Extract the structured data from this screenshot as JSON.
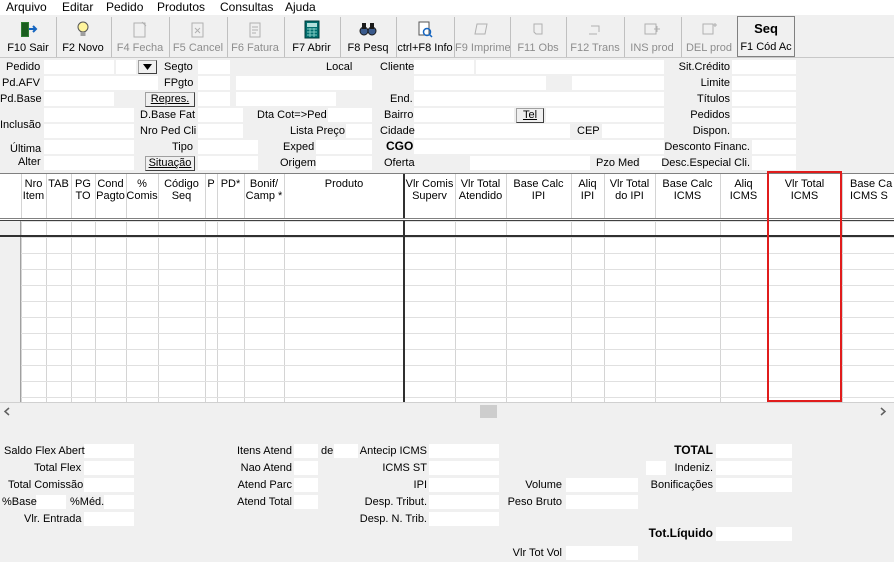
{
  "menu": [
    "Arquivo",
    "Editar",
    "Pedido",
    "Produtos",
    "Consultas",
    "Ajuda"
  ],
  "toolbar": [
    {
      "label": "F10 Sair",
      "icon": "exit-icon",
      "enabled": true
    },
    {
      "label": "F2 Novo",
      "icon": "lightbulb-icon",
      "enabled": true
    },
    {
      "label": "F4 Fecha",
      "icon": "close-doc-icon",
      "enabled": false
    },
    {
      "label": "F5 Cancel",
      "icon": "cancel-doc-icon",
      "enabled": false
    },
    {
      "label": "F6 Fatura",
      "icon": "invoice-icon",
      "enabled": false
    },
    {
      "label": "F7 Abrir",
      "icon": "calculator-icon",
      "enabled": true
    },
    {
      "label": "F8 Pesq",
      "icon": "binoculars-icon",
      "enabled": true
    },
    {
      "label": "ctrl+F8 Info",
      "icon": "info-search-icon",
      "enabled": true
    },
    {
      "label": "F9 Imprime",
      "icon": "printer-icon",
      "enabled": false
    },
    {
      "label": "F11 Obs",
      "icon": "note-icon",
      "enabled": false
    },
    {
      "label": "F12 Trans",
      "icon": "transfer-icon",
      "enabled": false
    },
    {
      "label": "INS prod",
      "icon": "insert-icon",
      "enabled": false
    },
    {
      "label": "DEL prod",
      "icon": "delete-icon",
      "enabled": false
    }
  ],
  "seq": {
    "title": "Seq",
    "label": "F1 Cód Ac"
  },
  "form": {
    "pedido": "Pedido",
    "pd_afv": "Pd.AFV",
    "pd_base": "Pd.Base",
    "inclusao": "Inclusão",
    "ultima": "Última",
    "alter": "Alter",
    "segto": "Segto",
    "fpgto": "FPgto",
    "repres": "Repres.",
    "d_base_fat": "D.Base Fat",
    "nro_ped_cli": "Nro Ped Cli",
    "tipo": "Tipo",
    "situacao": "Situação",
    "local": "Local",
    "dta_cot_ped": "Dta Cot=>Ped",
    "lista_preco": "Lista Preço",
    "exped": "Exped",
    "origem": "Origem",
    "cliente": "Cliente",
    "end": "End.",
    "bairro": "Bairro",
    "tel": "Tel",
    "cidade": "Cidade",
    "cgo": "CGO",
    "oferta": "Oferta",
    "cep": "CEP",
    "pzo_med": "Pzo Med",
    "sit_credito": "Sit.Crédito",
    "limite": "Limite",
    "titulos": "Títulos",
    "pedidos": "Pedidos",
    "dispon": "Dispon.",
    "desconto_financ": "Desconto Financ.",
    "desc_especial": "Desc.Especial Cli."
  },
  "grid": {
    "columns": [
      {
        "l1": "",
        "l2": ""
      },
      {
        "l1": "Nro",
        "l2": "Item"
      },
      {
        "l1": "TAB",
        "l2": ""
      },
      {
        "l1": "PG",
        "l2": "TO"
      },
      {
        "l1": "Cond",
        "l2": "Pagto"
      },
      {
        "l1": "%",
        "l2": "Comis"
      },
      {
        "l1": "Código",
        "l2": "Seq"
      },
      {
        "l1": "P",
        "l2": ""
      },
      {
        "l1": "PD*",
        "l2": ""
      },
      {
        "l1": "Bonif/",
        "l2": "Camp *"
      },
      {
        "l1": "Produto",
        "l2": ""
      },
      {
        "l1": "Vlr Comis",
        "l2": "Superv"
      },
      {
        "l1": "Vlr Total",
        "l2": "Atendido"
      },
      {
        "l1": "Base Calc",
        "l2": "IPI"
      },
      {
        "l1": "Aliq",
        "l2": "IPI"
      },
      {
        "l1": "Vlr Total",
        "l2": "do IPI"
      },
      {
        "l1": "Base Calc",
        "l2": "ICMS"
      },
      {
        "l1": "Aliq",
        "l2": "ICMS"
      },
      {
        "l1": "Vlr Total",
        "l2": "ICMS"
      },
      {
        "l1": "Base Ca",
        "l2": "ICMS S"
      }
    ]
  },
  "footer": {
    "saldo_flex_abert": "Saldo Flex Abert",
    "total_flex": "Total Flex",
    "total_comissao": "Total Comissão",
    "pct_base": "%Base",
    "pct_med": "%Méd.",
    "vlr_entrada": "Vlr. Entrada",
    "itens_atend": "Itens Atend",
    "de": "de",
    "nao_atend": "Nao Atend",
    "atend_parc": "Atend Parc",
    "atend_total": "Atend Total",
    "antecip_icms": "Antecip ICMS",
    "icms_st": "ICMS ST",
    "ipi": "IPI",
    "desp_tribut": "Desp. Tribut.",
    "desp_n_trib": "Desp. N. Trib.",
    "volume": "Volume",
    "peso_bruto": "Peso Bruto",
    "vlr_tot_vol": "Vlr Tot Vol",
    "total": "TOTAL",
    "indeniz": "Indeniz.",
    "bonificacoes": "Bonificações",
    "tot_liquido": "Tot.Líquido"
  }
}
